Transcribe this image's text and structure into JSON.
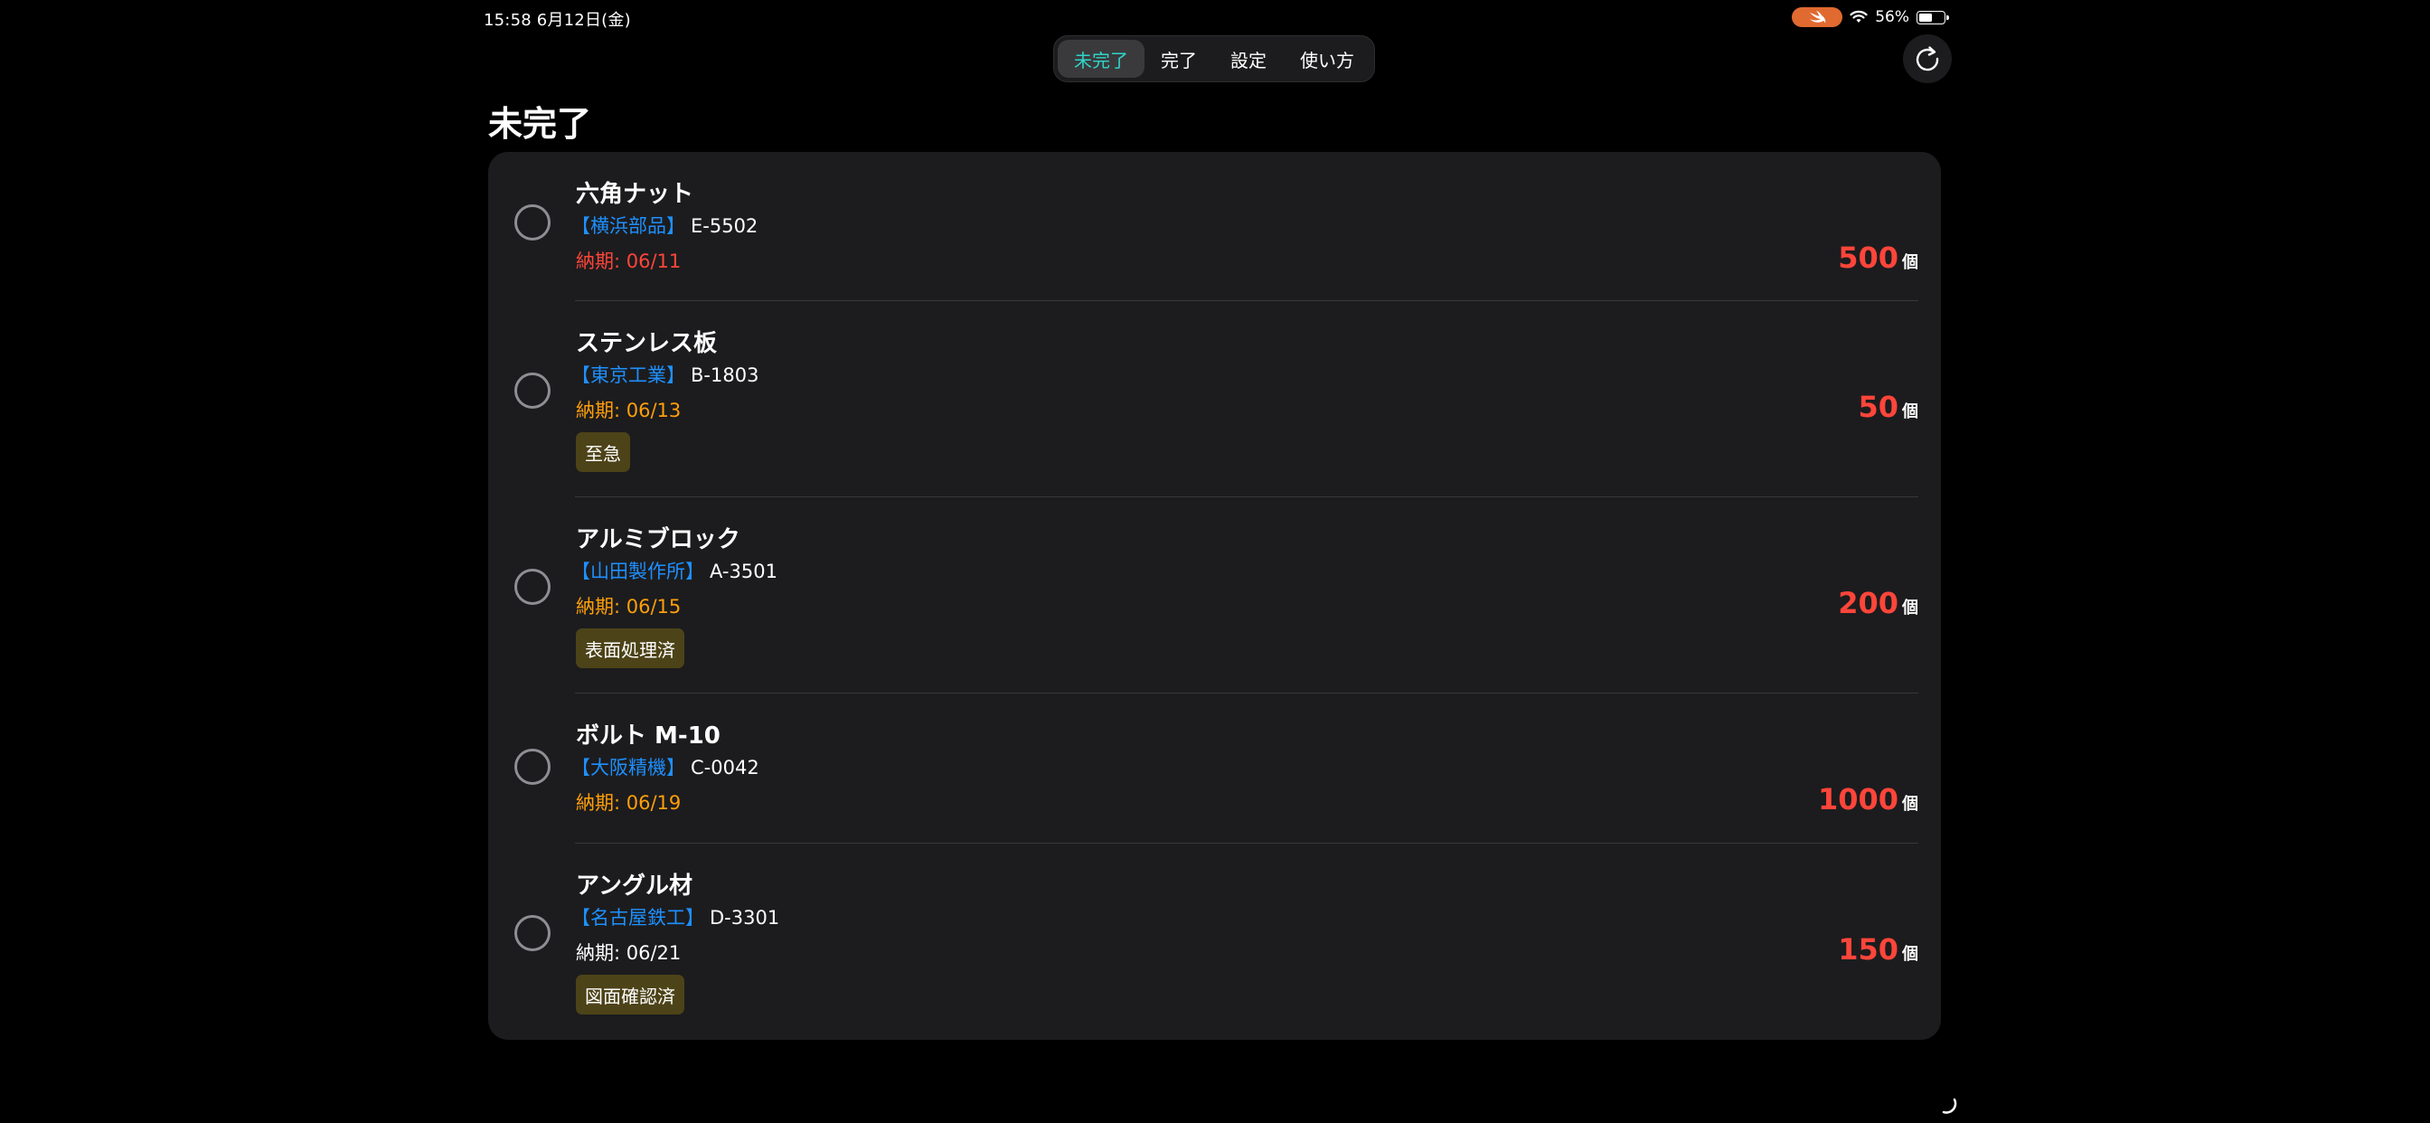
{
  "status_bar": {
    "time_date": "15:58   6月12日(金)",
    "battery_percent": "56%",
    "battery_level": 0.56
  },
  "tabs": [
    {
      "label": "未完了",
      "active": true
    },
    {
      "label": "完了",
      "active": false
    },
    {
      "label": "設定",
      "active": false
    },
    {
      "label": "使い方",
      "active": false
    }
  ],
  "page": {
    "title": "未完了"
  },
  "items": [
    {
      "name": "六角ナット",
      "supplier": "【横浜部品】",
      "code": "E-5502",
      "due": "納期: 06/11",
      "due_color": "#ff453a",
      "tag": "",
      "qty": "500",
      "unit": "個"
    },
    {
      "name": "ステンレス板",
      "supplier": "【東京工業】",
      "code": "B-1803",
      "due": "納期: 06/13",
      "due_color": "#ff9f0a",
      "tag": "至急",
      "qty": "50",
      "unit": "個"
    },
    {
      "name": "アルミブロック",
      "supplier": "【山田製作所】",
      "code": "A-3501",
      "due": "納期: 06/15",
      "due_color": "#ff9f0a",
      "tag": "表面処理済",
      "qty": "200",
      "unit": "個"
    },
    {
      "name": "ボルト M-10",
      "supplier": "【大阪精機】",
      "code": "C-0042",
      "due": "納期: 06/19",
      "due_color": "#ff9f0a",
      "tag": "",
      "qty": "1000",
      "unit": "個"
    },
    {
      "name": "アングル材",
      "supplier": "【名古屋鉄工】",
      "code": "D-3301",
      "due": "納期: 06/21",
      "due_color": "#ffffff",
      "tag": "図面確認済",
      "qty": "150",
      "unit": "個"
    }
  ],
  "colors": {
    "accent": "#30d5c8",
    "supplier": "#1e90ff",
    "quantity": "#ff453a",
    "tag_bg": "#4d4318"
  },
  "icons": {
    "refresh": "refresh-icon",
    "wifi": "wifi-icon",
    "battery": "battery-icon",
    "swift": "swift-icon",
    "check": "circle-icon"
  }
}
